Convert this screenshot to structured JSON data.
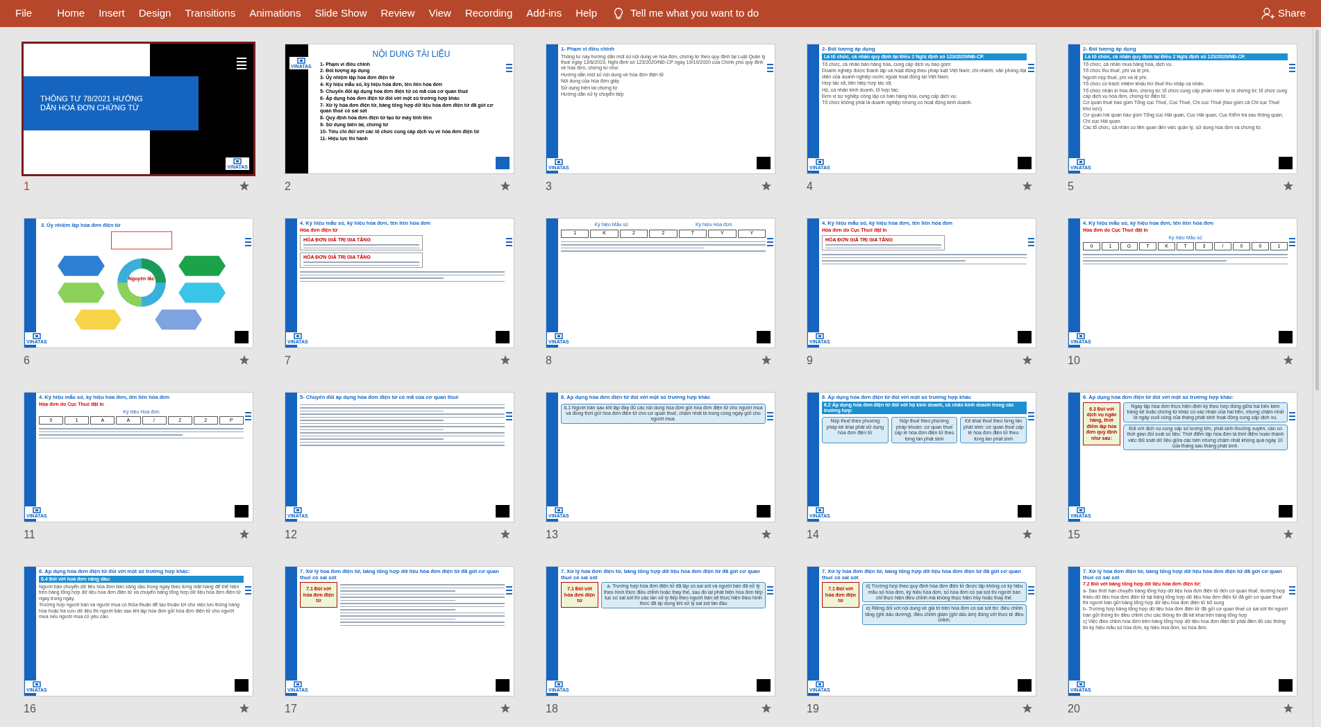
{
  "ribbon": {
    "tabs": [
      "File",
      "Home",
      "Insert",
      "Design",
      "Transitions",
      "Animations",
      "Slide Show",
      "Review",
      "View",
      "Recording",
      "Add-ins",
      "Help"
    ],
    "tell_me": "Tell me what you want to do",
    "share": "Share"
  },
  "slides": [
    {
      "number": "1",
      "selected": true,
      "kind": "title",
      "title": "THÔNG TƯ 78/2021 HƯỚNG DẪN HOÁ ĐƠN CHỨNG TỪ",
      "logo": "VINATAS"
    },
    {
      "number": "2",
      "selected": false,
      "kind": "toc",
      "title": "NỘI DUNG TÀI LIỆU",
      "logo": "VINATAS",
      "lines": [
        "1- Phạm vi điều chỉnh",
        "2- Đối tượng áp dụng",
        "3- Ủy nhiệm lập hóa đơn điện tử",
        "4- Ký hiệu mẫu số, ký hiệu hóa đơn, tên liên hóa đơn",
        "5- Chuyển đổi áp dụng hóa đơn điện tử có mã của cơ quan thuế",
        "6- Áp dụng hóa đơn điện tử đối với một số trường hợp khác",
        "7- Xử lý hóa đơn điện tử, bảng tổng hợp dữ liệu hóa đơn điện tử đã gửi cơ quan thuế có sai sót",
        "8- Quy định hóa đơn điện tử tạo từ máy tính tiền",
        "9- Sử dụng biên lai, chứng từ",
        "10- Tiêu chí đối với các tổ chức cung cấp dịch vụ về hóa đơn điện tử",
        "11- Hiệu lực thi hành"
      ]
    },
    {
      "number": "3",
      "selected": false,
      "kind": "content",
      "title": "1- Phạm vi điều chỉnh",
      "logo": "VINATAS",
      "lines": [
        "Thông tư này hướng dẫn một số nội dung về hóa đơn, chứng từ theo quy định tại Luật Quản lý thuế ngày 13/6/2019, Nghị định số 123/2020/NĐ-CP ngày 19/10/2020 của Chính phủ quy định về hóa đơn, chứng từ như:",
        "Hướng dẫn một số nội dung về hóa đơn điện tử",
        "Nội dung của hóa đơn giấy",
        "Sử dụng biên lai chứng từ",
        "Hướng dẫn xử lý chuyển tiếp"
      ]
    },
    {
      "number": "4",
      "selected": false,
      "kind": "content",
      "title": "2- Đối tượng áp dụng",
      "banner": "Là tổ chức, cá nhân quy định tại Điều 2 Nghị định số 123/2020/NĐ-CP.",
      "logo": "VINATAS",
      "lines": [
        "Tổ chức, cá nhân bán hàng hóa, cung cấp dịch vụ bao gồm:",
        "Doanh nghiệp được thành lập và hoạt động theo pháp luật Việt Nam; chi nhánh, văn phòng đại diện của doanh nghiệp nước ngoài hoạt động tại Việt Nam;",
        "Hợp tác xã, liên hiệp hợp tác xã;",
        "Hộ, cá nhân kinh doanh, tổ hợp tác;",
        "Đơn vị sự nghiệp công lập có bán hàng hóa, cung cấp dịch vụ;",
        "Tổ chức không phải là doanh nghiệp nhưng có hoạt động kinh doanh."
      ]
    },
    {
      "number": "5",
      "selected": false,
      "kind": "content",
      "title": "2- Đối tượng áp dụng",
      "banner": "Là tổ chức, cá nhân quy định tại Điều 2 Nghị định số 123/2020/NĐ-CP.",
      "logo": "VINATAS",
      "lines": [
        "Tổ chức, cá nhân mua hàng hóa, dịch vụ.",
        "Tổ chức thu thuế, phí và lệ phí.",
        "Người nộp thuế, phí và lệ phí.",
        "Tổ chức có trách nhiệm khấu trừ thuế thu nhập cá nhân.",
        "Tổ chức nhận in hóa đơn, chứng từ; tổ chức cung cấp phần mềm tự in chứng từ; tổ chức cung cấp dịch vụ hóa đơn, chứng từ điện tử.",
        "Cơ quan thuế bao gồm Tổng cục Thuế, Cục Thuế, Chi cục Thuế (bao gồm cả Chi cục Thuế khu vực).",
        "Cơ quan hải quan bao gồm Tổng cục Hải quan, Cục Hải quan, Cục Kiểm tra sau thông quan, Chi cục Hải quan.",
        "Các tổ chức, cá nhân có liên quan đến việc quản lý, sử dụng hóa đơn và chứng từ."
      ]
    },
    {
      "number": "6",
      "selected": false,
      "kind": "cycle",
      "title": "3. Ủy nhiệm lập hóa đơn điện tử",
      "center": "Nguyên tắc",
      "logo": "VINATAS"
    },
    {
      "number": "7",
      "selected": false,
      "kind": "content",
      "title": "4. Ký hiệu mẫu số, ký hiệu hóa đơn, tên liên hóa đơn",
      "subtitle": "Hóa đơn điện tử",
      "logo": "VINATAS",
      "invoices": [
        "HÓA ĐƠN GIÁ TRỊ GIA TĂNG",
        "HÓA ĐƠN GIÁ TRỊ GIA TĂNG"
      ]
    },
    {
      "number": "8",
      "selected": false,
      "kind": "content",
      "logo": "VINATAS",
      "code_labels": [
        "Ký hiệu Mẫu số",
        "Ký hiệu Hóa đơn"
      ],
      "codes": [
        "1",
        "K",
        "2",
        "2",
        "T",
        "Y",
        "Y"
      ]
    },
    {
      "number": "9",
      "selected": false,
      "kind": "content",
      "title": "4. Ký hiệu mẫu số, ký hiệu hóa đơn, tên liên hóa đơn",
      "subtitle": "Hóa đơn do Cục Thuế đặt in",
      "logo": "VINATAS",
      "invoices": [
        "HÓA ĐƠN GIÁ TRỊ GIA TĂNG"
      ]
    },
    {
      "number": "10",
      "selected": false,
      "kind": "content",
      "title": "4. Ký hiệu mẫu số, ký hiệu hóa đơn, tên liên hóa đơn",
      "subtitle": "Hóa đơn do Cục Thuế đặt in",
      "logo": "VINATAS",
      "code_labels": [
        "Ký hiệu Mẫu số"
      ],
      "codes": [
        "0",
        "1",
        "G",
        "T",
        "K",
        "T",
        "3",
        "/",
        "0",
        "0",
        "1"
      ]
    },
    {
      "number": "11",
      "selected": false,
      "kind": "content",
      "title": "4. Ký hiệu mẫu số, ký hiệu hóa đơn, tên liên hóa đơn",
      "subtitle": "Hóa đơn do Cục Thuế đặt in",
      "logo": "VINATAS",
      "code_labels": [
        "Ký hiệu Hóa đơn"
      ],
      "codes": [
        "0",
        "1",
        "A",
        "A",
        "/",
        "2",
        "2",
        "P"
      ]
    },
    {
      "number": "12",
      "selected": false,
      "kind": "content",
      "title": "5- Chuyển đổi áp dụng hóa đơn điện tử có mã của cơ quan thuế",
      "logo": "VINATAS"
    },
    {
      "number": "13",
      "selected": false,
      "kind": "content",
      "title": "6. Áp dụng hóa đơn điện tử đối với một số trường hợp khác",
      "logo": "VINATAS",
      "callouts": [
        "6.1 Người bán sau khi lập đầy đủ các nội dung hóa đơn gửi hóa đơn điện tử cho người mua và đồng thời gửi hóa đơn điện tử cho cơ quan thuế, chậm nhất là trong cùng ngày gửi cho người mua."
      ]
    },
    {
      "number": "14",
      "selected": false,
      "kind": "content",
      "title": "6. Áp dụng hóa đơn điện tử đối với một số trường hợp khác",
      "banner": "6.2 Áp dụng hóa đơn điện tử đối với hộ kinh doanh, cá nhân kinh doanh trong các trường hợp:",
      "logo": "VINATAS",
      "callouts": [
        "Nộp thuế theo phương pháp kê khai phải sử dụng hóa đơn điện tử",
        "Nộp thuế theo phương pháp khoán: cơ quan thuế cấp lẻ hóa đơn điện tử theo từng lần phát sinh",
        "Kê khai thuế theo từng lần phát sinh: cơ quan thuế cấp lẻ hóa đơn điện tử theo từng lần phát sinh"
      ]
    },
    {
      "number": "15",
      "selected": false,
      "kind": "content",
      "title": "6. Áp dụng hóa đơn điện tử đối với một số trường hợp khác:",
      "side": "6.3 Đối với dịch vụ ngân hàng, thời điểm lập hóa đơn quy định như sau:",
      "logo": "VINATAS",
      "callouts": [
        "Ngày lập hóa đơn thực hiện định kỳ theo hợp đồng giữa hai bên kèm bảng kê hoặc chứng từ khác có xác nhận của hai bên, nhưng chậm nhất là ngày cuối cùng của tháng phát sinh hoạt động cung cấp dịch vụ.",
        "Đối với dịch vụ cung cấp số lượng lớn, phát sinh thường xuyên, cần có thời gian đối soát số liệu: Thời điểm lập hóa đơn là thời điểm hoàn thành việc đối soát dữ liệu giữa các bên nhưng chậm nhất không quá ngày 10 của tháng sau tháng phát sinh."
      ]
    },
    {
      "number": "16",
      "selected": false,
      "kind": "content",
      "title": "6. Áp dụng hóa đơn điện tử đối với một số trường hợp khác:",
      "banner": "6.4 Đối với hoá đơn xăng dầu:",
      "logo": "VINATAS",
      "lines": [
        "Người bán chuyển dữ liệu hóa đơn bán xăng dầu trong ngày theo từng mặt hàng để thể hiện trên bảng tổng hợp dữ liệu hóa đơn điện tử và chuyển bảng tổng hợp dữ liệu hóa đơn điện tử ngay trong ngày.",
        "Trường hợp người bán và người mua có thỏa thuận để tạo thuận lợi cho việc lưu thông hàng hóa hoặc tra cứu dữ liệu thì người bán sau khi lập hóa đơn gửi hóa đơn điện tử cho người mua nếu người mua có yêu cầu."
      ]
    },
    {
      "number": "17",
      "selected": false,
      "kind": "content",
      "title": "7. Xử lý hóa đơn điện tử, bảng tổng hợp dữ liệu hóa đơn điện tử đã gửi cơ quan thuế có sai sót",
      "side": "7.1 Đối với hóa đơn điện tử",
      "logo": "VINATAS"
    },
    {
      "number": "18",
      "selected": false,
      "kind": "content",
      "title": "7. Xử lý hóa đơn điện tử, bảng tổng hợp dữ liệu hóa đơn điện tử đã gửi cơ quan thuế có sai sót",
      "side": "7.1 Đối với hóa đơn điện tử",
      "logo": "VINATAS",
      "callouts": [
        "a. Trường hợp hóa đơn điện tử đã lập có sai sót và người bán đã xử lý theo hình thức điều chỉnh hoặc thay thế, sau đó lại phát hiện hóa đơn tiếp tục có sai sót thì các lần xử lý tiếp theo người bán sẽ thực hiện theo hình thức đã áp dụng khi xử lý sai sót lần đầu"
      ]
    },
    {
      "number": "19",
      "selected": false,
      "kind": "content",
      "title": "7. Xử lý hóa đơn điện tử, bảng tổng hợp dữ liệu hóa đơn điện tử đã gửi cơ quan thuế có sai sót",
      "side": "7.1 Đối với hóa đơn điện tử",
      "logo": "VINATAS",
      "callouts": [
        "d) Trường hợp theo quy định hóa đơn điện tử được lập không có ký hiệu mẫu số hóa đơn, ký hiệu hóa đơn, số hóa đơn có sai sót thì người bán chỉ thực hiện điều chỉnh mà không thực hiện hủy hoặc thay thế.",
        "e) Riêng đối với nội dung về giá trị trên hóa đơn có sai sót thì: điều chỉnh tăng (ghi dấu dương), điều chỉnh giảm (ghi dấu âm) đúng với thực tế điều chỉnh."
      ]
    },
    {
      "number": "20",
      "selected": false,
      "kind": "content",
      "title": "7. Xử lý hóa đơn điện tử, bảng tổng hợp dữ liệu hóa đơn điện tử đã gửi cơ quan thuế có sai sót",
      "subtitle": "7.2 Đối với bảng tổng hợp dữ liệu hóa đơn điện tử:",
      "logo": "VINATAS",
      "lines": [
        "a- Sau thời hạn chuyển bảng tổng hợp dữ liệu hóa đơn điện tử đến cơ quan thuế, trường hợp thiếu dữ liệu hóa đơn điện tử tại bảng tổng hợp dữ liệu hóa đơn điện tử đã gửi cơ quan thuế thì người bán gửi bảng tổng hợp dữ liệu hóa đơn điện tử bổ sung",
        "b- Trường hợp bảng tổng hợp dữ liệu hóa đơn điện tử đã gửi cơ quan thuế có sai sót thì người bán gửi thông tin điều chỉnh cho các thông tin đã kê khai trên bảng tổng hợp",
        "c) Việc điều chỉnh hóa đơn trên bảng tổng hợp dữ liệu hóa đơn điện tử phải điền đủ các thông tin ký hiệu mẫu số hóa đơn, ký hiệu hóa đơn, số hóa đơn."
      ]
    }
  ]
}
